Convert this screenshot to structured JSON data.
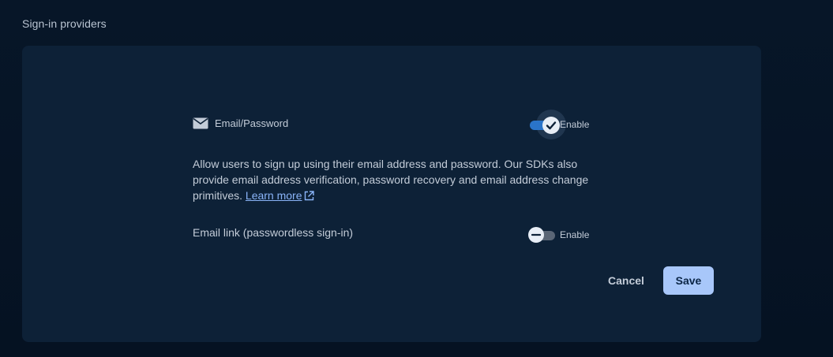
{
  "section": {
    "title": "Sign-in providers"
  },
  "email_password": {
    "icon": "mail-icon",
    "label": "Email/Password",
    "toggle_state": "on",
    "toggle_label": "Enable",
    "description": "Allow users to sign up using their email address and password. Our SDKs also provide email address verification, password recovery and email address change primitives.",
    "learn_more": "Learn more",
    "learn_more_icon": "open-in-new-icon"
  },
  "email_link": {
    "label": "Email link (passwordless sign-in)",
    "toggle_state": "off",
    "toggle_label": "Enable"
  },
  "actions": {
    "cancel_label": "Cancel",
    "save_label": "Save"
  },
  "colors": {
    "accent": "#2a74c9",
    "save_button": "#a8c7fa",
    "link": "#8ab4f8",
    "panel": "#0d2137",
    "background": "#061425"
  }
}
